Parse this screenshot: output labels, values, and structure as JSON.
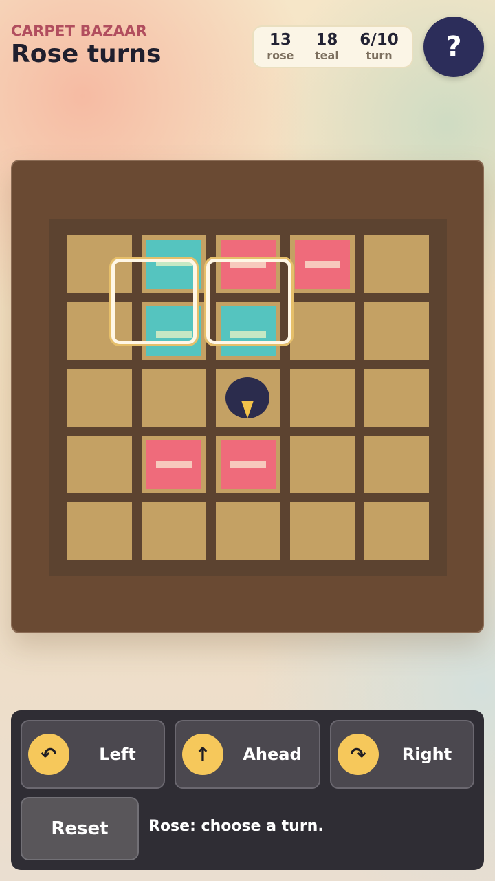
{
  "header": {
    "subtitle": "CARPET BAZAAR",
    "title": "Rose turns"
  },
  "scores": [
    {
      "value": "13",
      "label": "rose"
    },
    {
      "value": "18",
      "label": "teal"
    },
    {
      "value": "6/10",
      "label": "turn"
    }
  ],
  "help": {
    "label": "?"
  },
  "board": {
    "size": 5,
    "carpets": [
      {
        "row": 0,
        "col": 1,
        "color": "teal"
      },
      {
        "row": 0,
        "col": 2,
        "color": "rose"
      },
      {
        "row": 0,
        "col": 3,
        "color": "rose"
      },
      {
        "row": 1,
        "col": 1,
        "color": "teal"
      },
      {
        "row": 1,
        "col": 2,
        "color": "teal"
      },
      {
        "row": 3,
        "col": 1,
        "color": "rose"
      },
      {
        "row": 3,
        "col": 2,
        "color": "rose"
      }
    ],
    "piece": {
      "row": 2,
      "col": 2,
      "facing": "down"
    },
    "colors": {
      "rose": "#ef6b7b",
      "teal": "#55c4bf",
      "tile": "#c4a164",
      "frame": "#6a4a33",
      "piece": "#2b2c4d",
      "accent": "#f6c85b"
    }
  },
  "controls": {
    "left": {
      "icon": "↶",
      "label": "Left"
    },
    "ahead": {
      "icon": "↑",
      "label": "Ahead"
    },
    "right": {
      "icon": "↷",
      "label": "Right"
    },
    "reset": "Reset",
    "status": "Rose: choose a turn."
  }
}
